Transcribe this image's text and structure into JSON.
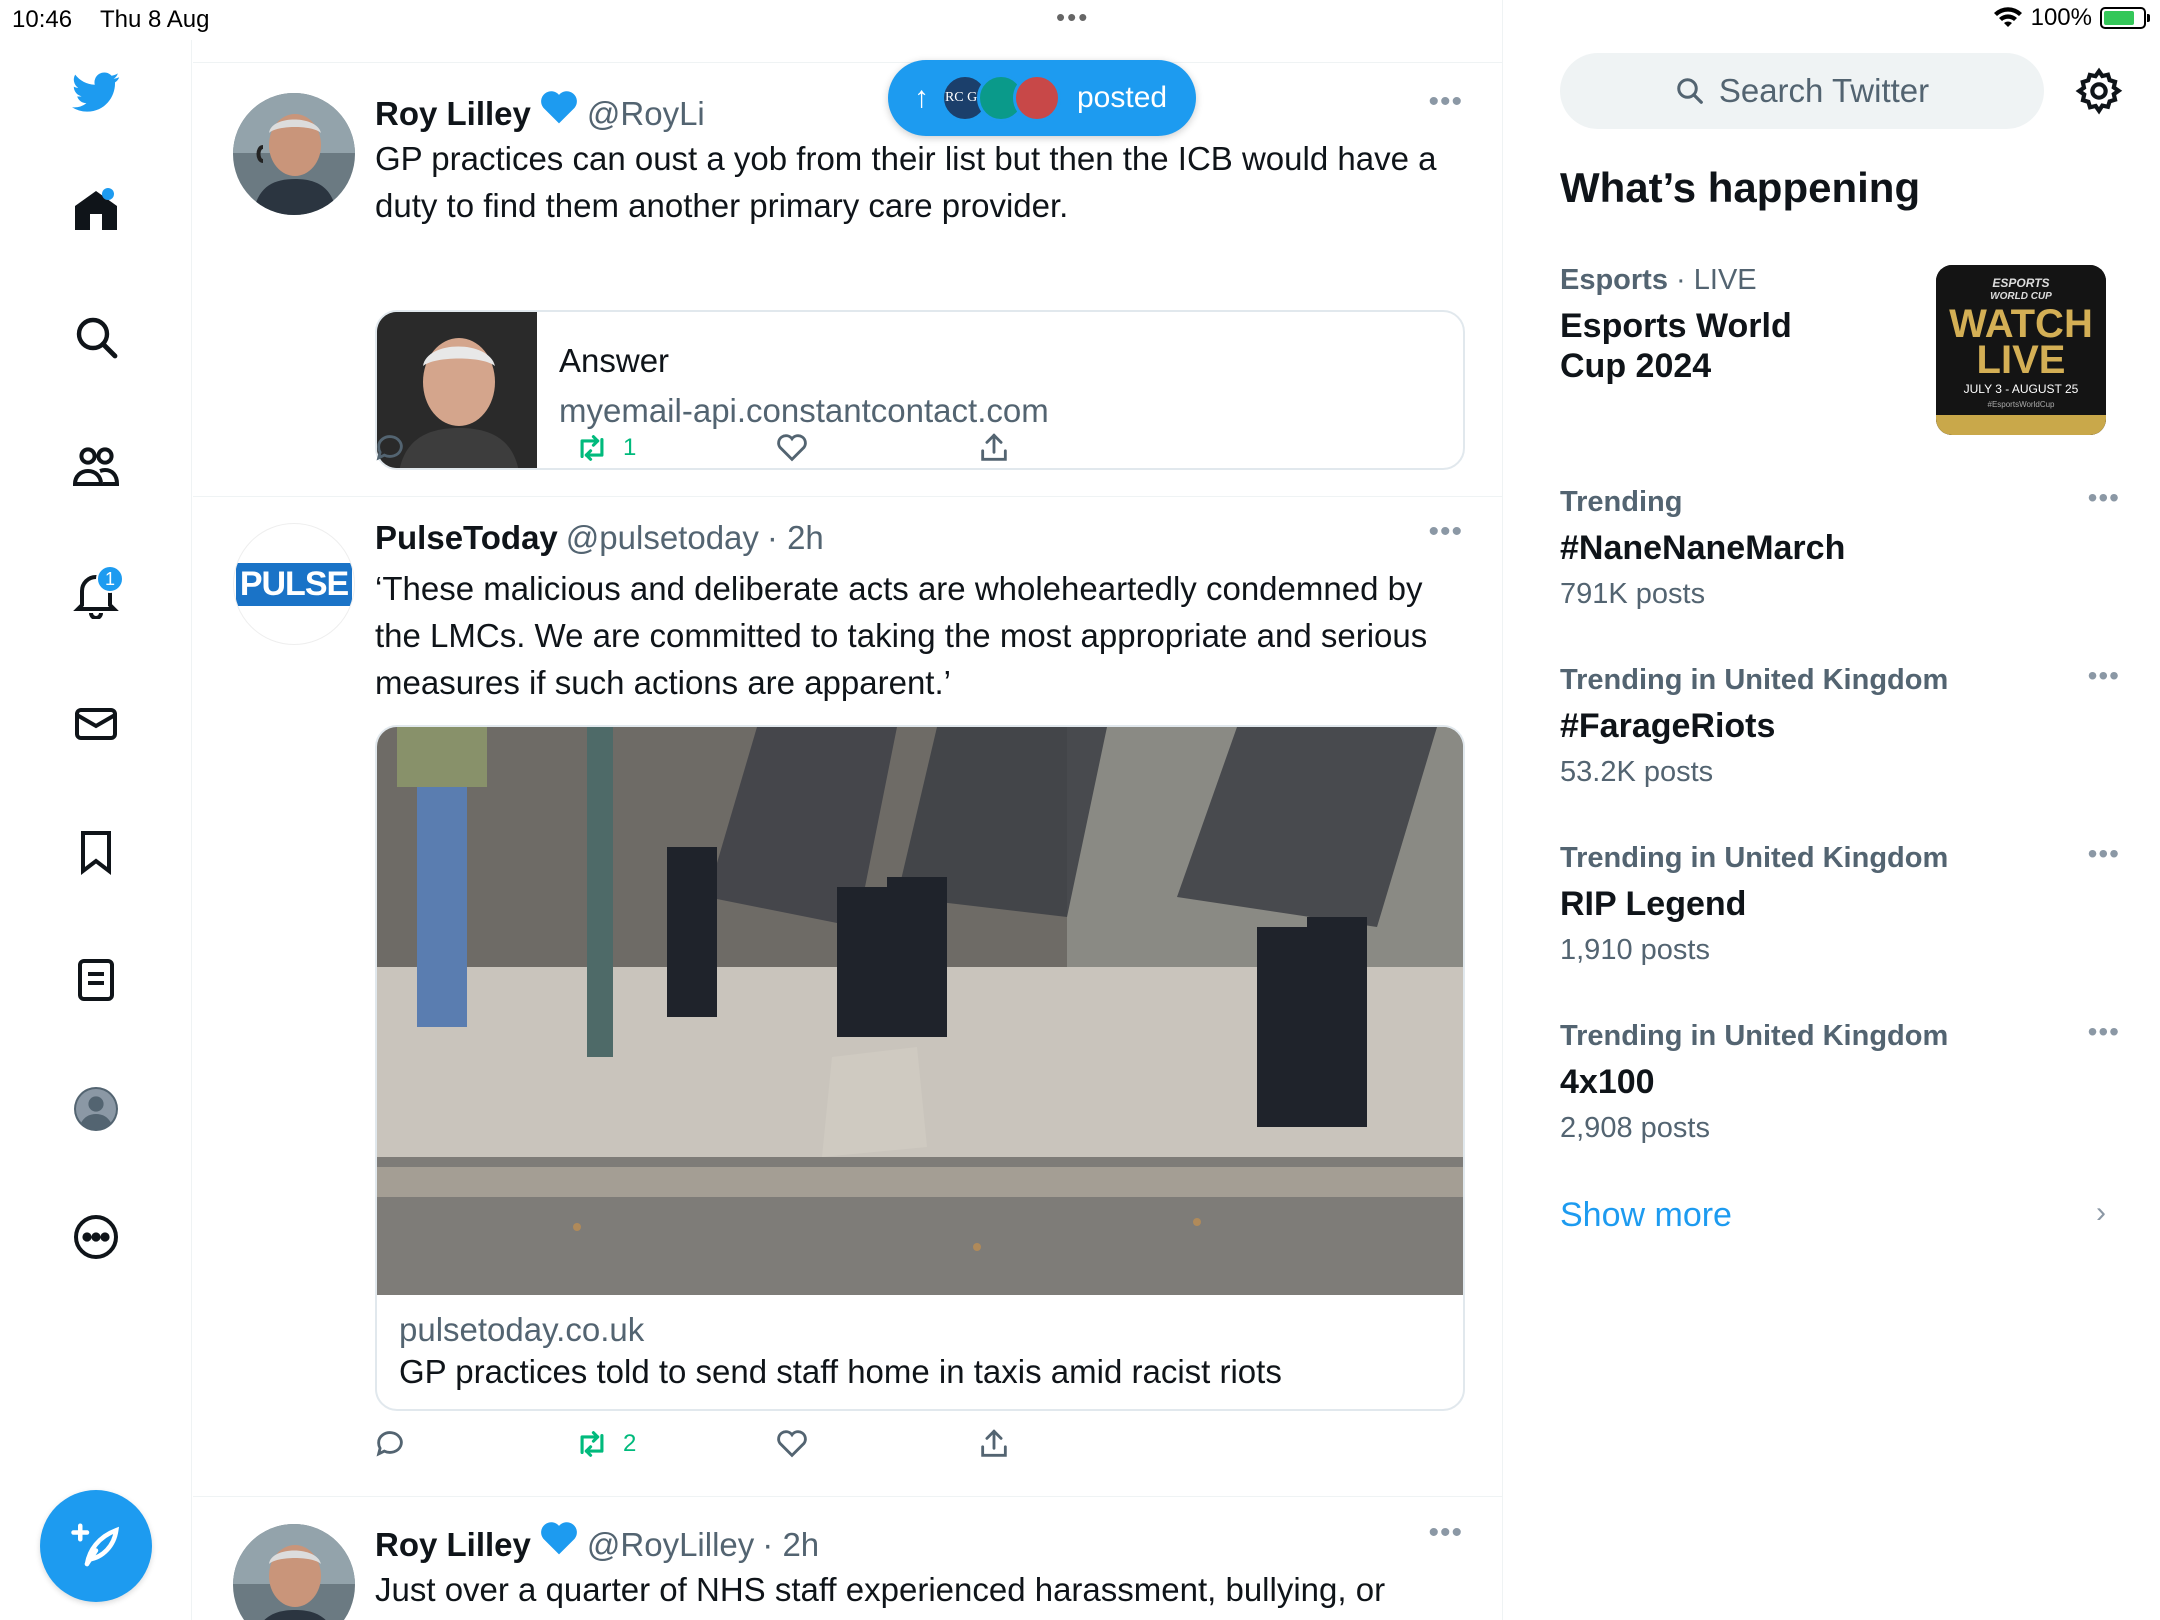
{
  "status_bar": {
    "time": "10:46",
    "date": "Thu 8 Aug",
    "battery": "100%",
    "battery_level": 1.0,
    "battery_color": "#34c759"
  },
  "colors": {
    "accent": "#1d9bf0",
    "retweet": "#00ba7c",
    "text": "#0f1419",
    "secondary": "#536471"
  },
  "nav": {
    "items": [
      "twitter-logo",
      "home",
      "explore",
      "communities",
      "notifications",
      "messages",
      "bookmarks",
      "lists",
      "profile",
      "more"
    ],
    "notifications_badge": "1"
  },
  "posted_pill": {
    "label": "posted",
    "avatar_text": "RC GP"
  },
  "tweets": [
    {
      "name": "Roy Lilley",
      "handle": "@RoyLi",
      "text": "GP practices can oust a yob from their list but then the ICB would have a duty to find them another primary care provider.",
      "card": {
        "title": "Answer",
        "domain": "myemail-api.constantcontact.com"
      },
      "retweets": "1"
    },
    {
      "name": "PulseToday",
      "handle": "@pulsetoday",
      "time": "· 2h",
      "avatar_text": "PULSE",
      "text": "‘These malicious and deliberate acts are wholeheartedly condemned by the LMCs. We are committed to taking the most appropriate and serious measures if such actions are apparent.’",
      "card": {
        "domain": "pulsetoday.co.uk",
        "title": "GP practices told to send staff home in taxis amid racist riots"
      },
      "retweets": "2"
    },
    {
      "name": "Roy Lilley",
      "handle": "@RoyLilley",
      "time": "· 2h",
      "text": "Just over a quarter of NHS staff experienced harassment, bullying, or"
    }
  ],
  "right": {
    "search_placeholder": "Search Twitter",
    "section_title": "What’s happening",
    "featured": {
      "category": "Esports",
      "status": "· LIVE",
      "title": "Esports World Cup 2024",
      "image_text": {
        "line1": "ESPORTS",
        "line2": "WORLD CUP",
        "watch": "WATCH",
        "live": "LIVE",
        "dates": "JULY 3 - AUGUST 25",
        "tag": "#EsportsWorldCup"
      }
    },
    "trends": [
      {
        "category": "Trending",
        "name": "#NaneNaneMarch",
        "count": "791K posts"
      },
      {
        "category": "Trending in United Kingdom",
        "name": "#FarageRiots",
        "count": "53.2K posts"
      },
      {
        "category": "Trending in United Kingdom",
        "name": "RIP Legend",
        "count": "1,910 posts"
      },
      {
        "category": "Trending in United Kingdom",
        "name": "4x100",
        "count": "2,908 posts"
      }
    ],
    "show_more": "Show more"
  }
}
